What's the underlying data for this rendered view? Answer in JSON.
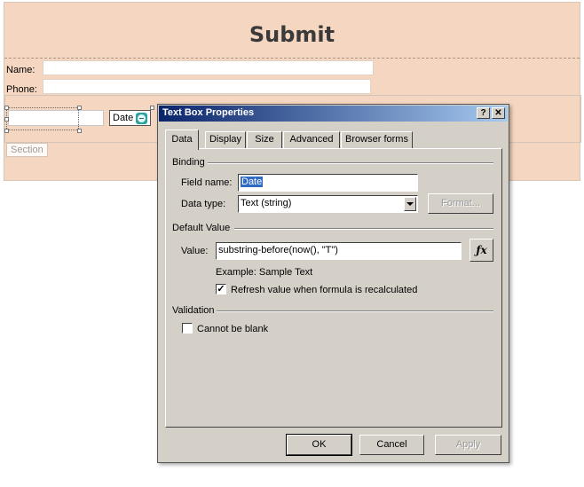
{
  "form": {
    "title": "Submit",
    "name_label": "Name:",
    "phone_label": "Phone:",
    "date_control_label": "Date",
    "date_icon": "date-picker-icon",
    "section_label": "Section"
  },
  "dialog": {
    "title": "Text Box Properties",
    "help_button": "?",
    "close_button": "X",
    "tabs": [
      "Data",
      "Display",
      "Size",
      "Advanced",
      "Browser forms"
    ],
    "active_tab": "Data",
    "binding": {
      "group_label": "Binding",
      "field_name_label": "Field name:",
      "field_name_value": "Date",
      "data_type_label": "Data type:",
      "data_type_value": "Text (string)",
      "format_button": "Format..."
    },
    "default_value": {
      "group_label": "Default Value",
      "value_label": "Value:",
      "value": "substring-before(now(), \"T\")",
      "fx_button": "fx",
      "example_text": "Example: Sample Text",
      "refresh_label": "Refresh value when formula is recalculated",
      "refresh_checked": true
    },
    "validation": {
      "group_label": "Validation",
      "cannot_be_blank_label": "Cannot be blank",
      "cannot_be_blank_checked": false
    },
    "buttons": {
      "ok": "OK",
      "cancel": "Cancel",
      "apply": "Apply"
    }
  },
  "colors": {
    "form_background": "#f5d6c0",
    "dialog_face": "#d4d0c8",
    "titlebar_start": "#0a246a",
    "titlebar_end": "#a6caf0",
    "selection": "#316ac5"
  }
}
